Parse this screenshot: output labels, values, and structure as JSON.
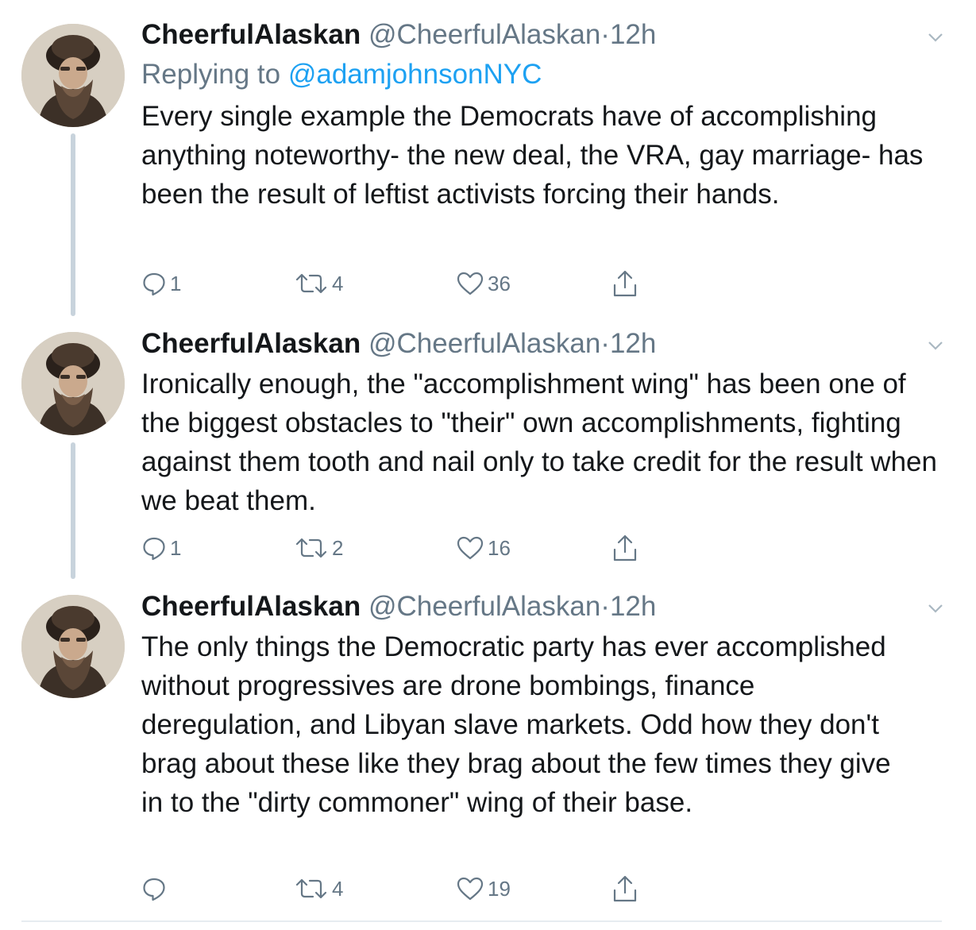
{
  "tweets": [
    {
      "name": "CheerfulAlaskan",
      "handle": "@CheerfulAlaskan",
      "dot": "·",
      "time": "12h",
      "replying_prefix": "Replying to ",
      "replying_to": "@adamjohnsonNYC",
      "text": "Every single example the Democrats have of accomplishing anything noteworthy- the new deal, the VRA, gay marriage- has been the result of leftist activists forcing their hands.",
      "replies": "1",
      "retweets": "4",
      "likes": "36"
    },
    {
      "name": "CheerfulAlaskan",
      "handle": "@CheerfulAlaskan",
      "dot": "·",
      "time": "12h",
      "text": "Ironically enough, the \"accomplishment wing\" has been one of the biggest obstacles to \"their\" own accomplishments, fighting against them tooth and nail only to take credit for the result when we beat them.",
      "replies": "1",
      "retweets": "2",
      "likes": "16"
    },
    {
      "name": "CheerfulAlaskan",
      "handle": "@CheerfulAlaskan",
      "dot": "·",
      "time": "12h",
      "text": "The only things the Democratic party has ever accomplished without progressives are drone bombings, finance deregulation, and Libyan slave markets. Odd how they don't brag about these like they brag about the few times they give in to the \"dirty commoner\" wing of their base.",
      "replies": "",
      "retweets": "4",
      "likes": "19"
    }
  ],
  "icons": {
    "reply": "reply-icon",
    "retweet": "retweet-icon",
    "like": "heart-icon",
    "share": "share-icon",
    "menu": "chevron-down-icon"
  },
  "colors": {
    "text": "#14171a",
    "secondary": "#657786",
    "link": "#1da1f2",
    "thread_line": "#c8d3dc"
  }
}
